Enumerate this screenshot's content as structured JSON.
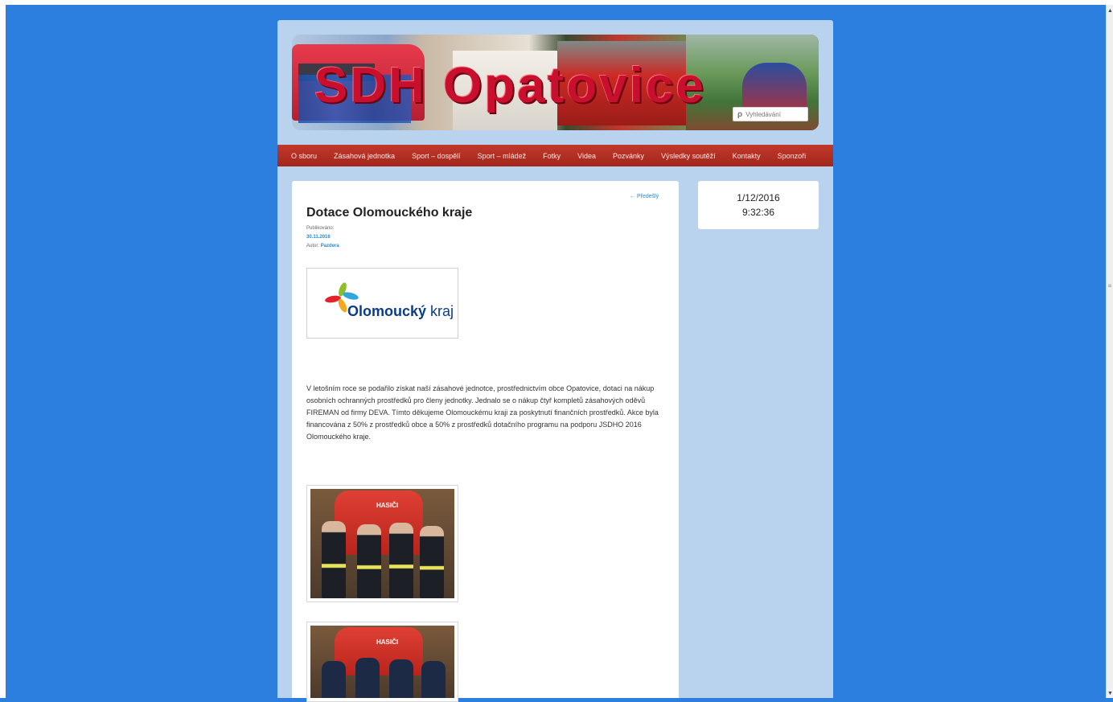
{
  "site": {
    "title": "SDH Opatovice",
    "search_placeholder": "Vyhledávání"
  },
  "nav": {
    "items": [
      "O sboru",
      "Zásahová jednotka",
      "Sport – dospělí",
      "Sport – mládež",
      "Fotky",
      "Videa",
      "Pozvánky",
      "Výsledky soutěží",
      "Kontakty",
      "Sponzoři"
    ]
  },
  "post": {
    "prev_link": "← Předešlý",
    "title": "Dotace Olomouckého kraje",
    "published_label": "Publikováno:",
    "date": "30.11.2016",
    "author_label": "Autor:",
    "author": "Pazdera",
    "logo": {
      "text_bold": "Olomoucký",
      "text_regular": " kraj"
    },
    "body": "V letošním roce se podařilo získat naší zásahové jednotce, prostřednictvím obce Opatovice, dotaci na nákup osobních ochranných prostředků pro členy jednotky. Jednalo se o nákup čtyř kompletů zásahových oděvů FIREMAN od firmy DEVA. Tímto děkujeme Olomouckému kraji za poskytnutí finančních prostředků. Akce byla financována z 50% z prostředků obce a 50% z prostředků dotačního programu na podporu JSDHO 2016 Olomouckého kraje.",
    "photo1_label": "HASIČI",
    "photo2_label": "HASIČI"
  },
  "sidebar": {
    "date": "1/12/2016",
    "time": "9:32:36"
  },
  "icons": {
    "search": "search-icon",
    "scroll_up": "scroll-up-icon",
    "scroll_down": "scroll-down-icon"
  }
}
